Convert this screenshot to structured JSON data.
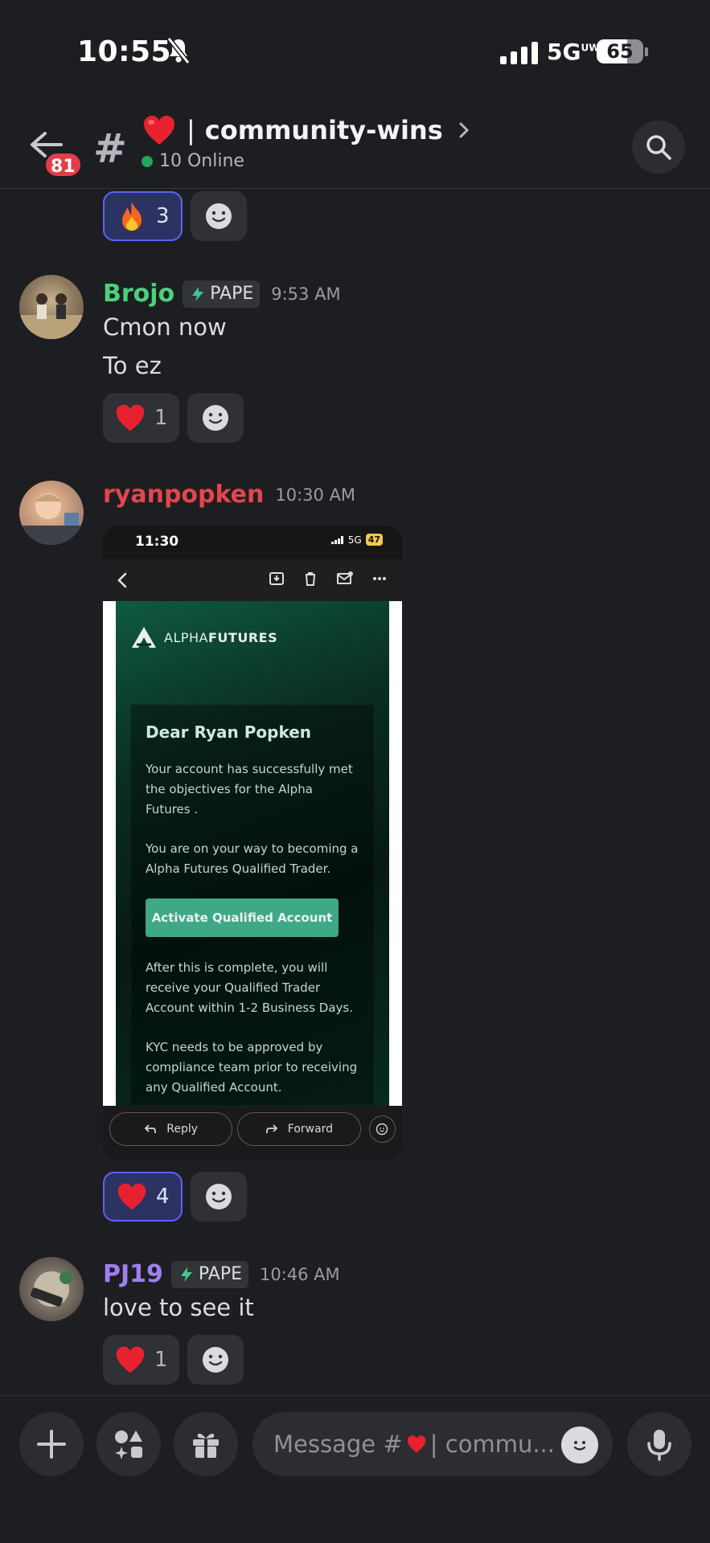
{
  "status_bar": {
    "time": "10:55",
    "network": "5G",
    "battery": "65",
    "battery_level": 0.65
  },
  "header": {
    "unread_count": "81",
    "channel_separator": "|",
    "channel_name": "community-wins",
    "online_text": "10 Online"
  },
  "messages": [
    {
      "reactions": [
        {
          "emoji": "fire",
          "count": "3",
          "mine": true
        }
      ]
    },
    {
      "username": "Brojo",
      "username_color": "#4cd07d",
      "tag": "PAPE",
      "timestamp": "9:53 AM",
      "lines": [
        "Cmon now",
        "To ez"
      ],
      "reactions": [
        {
          "emoji": "heart",
          "count": "1",
          "mine": false
        }
      ]
    },
    {
      "username": "ryanpopken",
      "username_color": "#e0474c",
      "timestamp": "10:30 AM",
      "attachment": {
        "phone_time": "11:30",
        "phone_network": "5G",
        "phone_battery": "47",
        "brand_light": "ALPHA",
        "brand_bold": "FUTURES",
        "greeting": "Dear Ryan Popken",
        "paragraphs": [
          "Your account has successfully met the objectives for the Alpha Futures .",
          "You are on your way to becoming a Alpha Futures Qualified Trader."
        ],
        "button": "Activate Qualified Account",
        "paragraphs_after": [
          "After this is complete, you will receive your Qualified Trader Account within 1-2 Business Days.",
          "KYC needs to be approved by compliance team prior to receiving any Qualified Account."
        ],
        "reply": "Reply",
        "forward": "Forward"
      },
      "reactions": [
        {
          "emoji": "heart",
          "count": "4",
          "mine": true
        }
      ]
    },
    {
      "username": "PJ19",
      "username_color": "#9f7ff0",
      "tag": "PAPE",
      "timestamp": "10:46 AM",
      "lines": [
        "love to see it"
      ],
      "reactions": [
        {
          "emoji": "heart",
          "count": "1",
          "mine": false
        }
      ]
    }
  ],
  "composer": {
    "placeholder_prefix": "Message #",
    "placeholder_suffix": "| commu..."
  }
}
